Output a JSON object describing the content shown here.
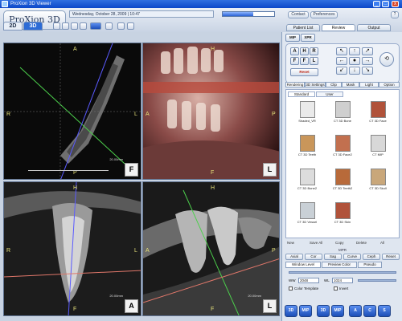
{
  "window": {
    "title": "ProXion 3D Viewer",
    "min": "_",
    "max": "□",
    "close": "x"
  },
  "header": {
    "logo": "ProXion 3D",
    "date": "Wednesday, October 28, 2009 | 10:47",
    "progress_label": "",
    "progress_value": 0.6,
    "contact_label": "Contact",
    "preferences_label": "Preferences",
    "help_label": "?"
  },
  "mode_tabs": {
    "twod": "2D",
    "threed": "3D"
  },
  "right_tabs": {
    "patient_list": "Patient List",
    "review": "Review",
    "output": "Output"
  },
  "viewports": {
    "axial": {
      "top": "A",
      "left": "R",
      "right": "L",
      "bottom": "P",
      "orient": "F",
      "scale": "20.00mm"
    },
    "volume": {
      "top": "H",
      "left": "A",
      "right": "P",
      "bottom": "F",
      "orient": "L",
      "scale": ""
    },
    "coronal": {
      "top": "H",
      "left": "R",
      "right": "L",
      "bottom": "F",
      "orient": "A",
      "scale": "20.00mm"
    },
    "sagittal": {
      "top": "H",
      "left": "A",
      "right": "P",
      "bottom": "F",
      "orient": "L",
      "scale": "20.00mm"
    }
  },
  "controls": {
    "grid_letters": [
      "A",
      "H",
      "R",
      "F",
      "F",
      "L"
    ],
    "top_labels": [
      "MIP",
      "XPR"
    ],
    "reset_label": "Reset"
  },
  "panel_tabs": [
    "Rendering",
    "3D Settings",
    "Clip",
    "Mask",
    "Light",
    "Option"
  ],
  "preset_subtabs": [
    "Standard",
    "User"
  ],
  "presets": [
    {
      "label": "Shaded_VR",
      "color": "#eaeaea"
    },
    {
      "label": "CT 3D Bone",
      "color": "#cfcfcf"
    },
    {
      "label": "CT 3D Face",
      "color": "#b0523a"
    },
    {
      "label": "CT 3D Teeth",
      "color": "#c9965a"
    },
    {
      "label": "CT 3D Face2",
      "color": "#c2704f"
    },
    {
      "label": "CT MIP",
      "color": "#d8d8d8"
    },
    {
      "label": "CT 3D Bone2",
      "color": "#dcdcdc"
    },
    {
      "label": "CT 3D Teeth2",
      "color": "#b86a3a"
    },
    {
      "label": "CT 3D Skull",
      "color": "#c9a77a"
    },
    {
      "label": "CT 3D Vessel",
      "color": "#c9d0d6"
    },
    {
      "label": "CT 3D Skin",
      "color": "#b0523a"
    }
  ],
  "preset_actions": {
    "new": "New",
    "save": "Save All",
    "copy": "Copy",
    "delete": "Delete",
    "all": "All"
  },
  "sections": {
    "mpr": "MPR",
    "window_level": "Window Level"
  },
  "wl_buttons": [
    "Axial",
    "Cor",
    "Sag",
    "Curve",
    "Ceph",
    "Reset"
  ],
  "wl_tabs": [
    "Window Level",
    "Preview Color",
    "Pseudo"
  ],
  "wl_fields": {
    "ww_label": "WW",
    "ww_value": "2048",
    "wl_label": "WL",
    "wl_value": "1024"
  },
  "options": {
    "color_template": "Color Template",
    "invert": "Invert"
  },
  "bottom_buttons": [
    "3D",
    "MIP",
    "3D",
    "MIP",
    "A",
    "C",
    "S"
  ]
}
